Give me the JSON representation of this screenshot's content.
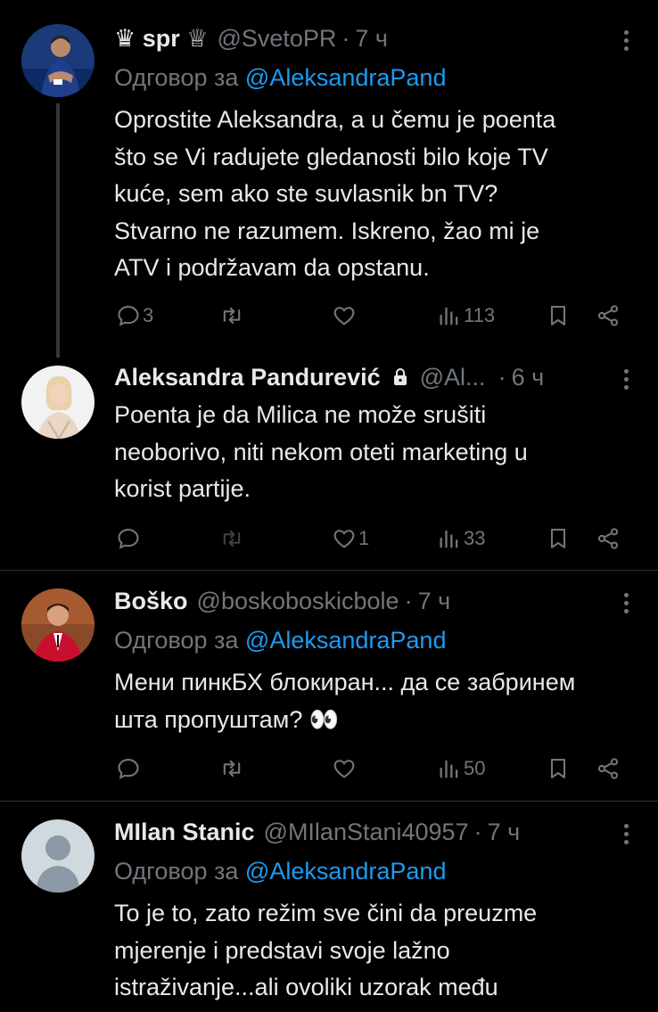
{
  "tweets": [
    {
      "name": "♛ spr ♕",
      "handle": "@SvetoPR",
      "dot": "·",
      "time": "7 ч",
      "reply_prefix": "Одговор за",
      "reply_to": "@AleksandraPand",
      "lines": [
        "Oprostite Aleksandra, a u čemu je poenta",
        "što se Vi radujete gledanosti bilo koje TV",
        "kuće, sem ako ste suvlasnik bn TV?",
        "Stvarno ne razumem. Iskreno, žao mi je",
        "ATV i podržavam da opstanu."
      ],
      "replies": "3",
      "reposts": "",
      "likes": "",
      "views": "113",
      "avatar": "tennis-player-avatar"
    },
    {
      "name": "Aleksandra Pandurević",
      "handle": "@Al...",
      "dot": "·",
      "time": "6 ч",
      "lines": [
        "Poenta je da Milica ne može srušiti",
        "neoborivo, niti nekom oteti marketing  u",
        "korist partije."
      ],
      "replies": "",
      "reposts": "",
      "likes": "1",
      "views": "33",
      "avatar": "blonde-woman-avatar",
      "locked_icon": "lock-icon"
    },
    {
      "name": "Boško",
      "handle": "@boskoboskicbole",
      "dot": "·",
      "time": "7 ч",
      "reply_prefix": "Одговор за",
      "reply_to": "@AleksandraPand",
      "lines": [
        "Мени пинкБХ блокиран... да се забринем",
        "шта пропуштам? 👀"
      ],
      "replies": "",
      "reposts": "",
      "likes": "",
      "views": "50",
      "avatar": "man-red-jacket-avatar"
    },
    {
      "name": "MIlan Stanic",
      "handle": "@MIlanStani40957",
      "dot": "·",
      "time": "7 ч",
      "reply_prefix": "Одговор за",
      "reply_to": "@AleksandraPand",
      "lines": [
        "To je to, zato režim sve čini da preuzme",
        "mjerenje i predstavi svoje lažno",
        "istraživanje...ali ovoliki uzorak među"
      ],
      "avatar": "default-profile-avatar"
    }
  ],
  "colors": {
    "background": "#000000",
    "text": "#e7e9ea",
    "muted": "#71767b",
    "link": "#1d9bf0",
    "divider": "#2f3336"
  },
  "icons": [
    "reply-icon",
    "repost-icon",
    "like-icon",
    "views-icon",
    "bookmark-icon",
    "share-icon",
    "more-icon",
    "lock-icon"
  ]
}
